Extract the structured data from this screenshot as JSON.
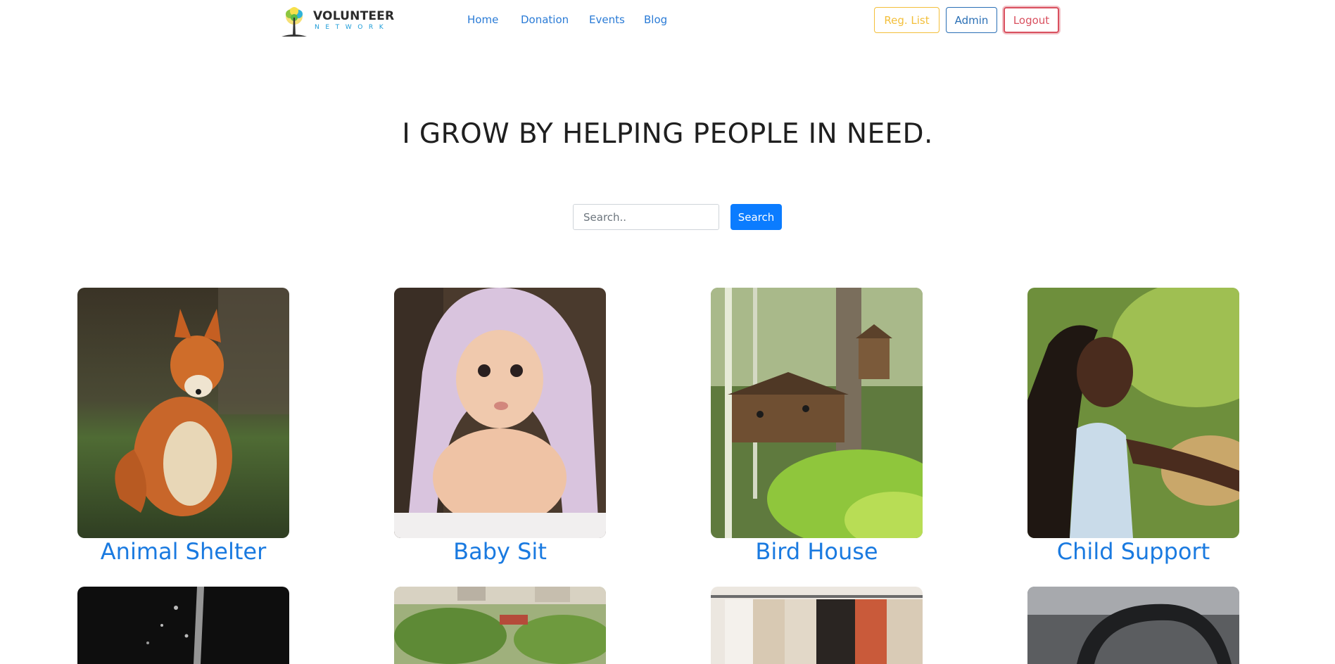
{
  "brand": {
    "line1": "VOLUNTEER",
    "line2": "NETWORK",
    "icon": "tree-logo-icon"
  },
  "nav": {
    "items": [
      "Home",
      "Donation",
      "Events",
      "Blog"
    ]
  },
  "header_buttons": {
    "reg_list": "Reg. List",
    "admin": "Admin",
    "logout": "Logout"
  },
  "hero": {
    "headline": "I GROW BY HELPING PEOPLE IN NEED."
  },
  "search": {
    "placeholder": "Search..",
    "button": "Search"
  },
  "cards": [
    {
      "title": "Animal Shelter",
      "image": "fox-photo"
    },
    {
      "title": "Baby Sit",
      "image": "baby-photo"
    },
    {
      "title": "Bird House",
      "image": "birdhouse-photo"
    },
    {
      "title": "Child Support",
      "image": "child-photo"
    }
  ],
  "cards_row2": [
    {
      "image": "water-photo"
    },
    {
      "image": "park-photo"
    },
    {
      "image": "clothes-rack-photo"
    },
    {
      "image": "car-steering-photo"
    }
  ],
  "colors": {
    "link": "#2a7bd6",
    "title_blue": "#1a7ae0",
    "search_button": "#0b7cff",
    "reg": "#f3bf3a",
    "admin": "#2a6fb5",
    "logout": "#d9505f"
  }
}
